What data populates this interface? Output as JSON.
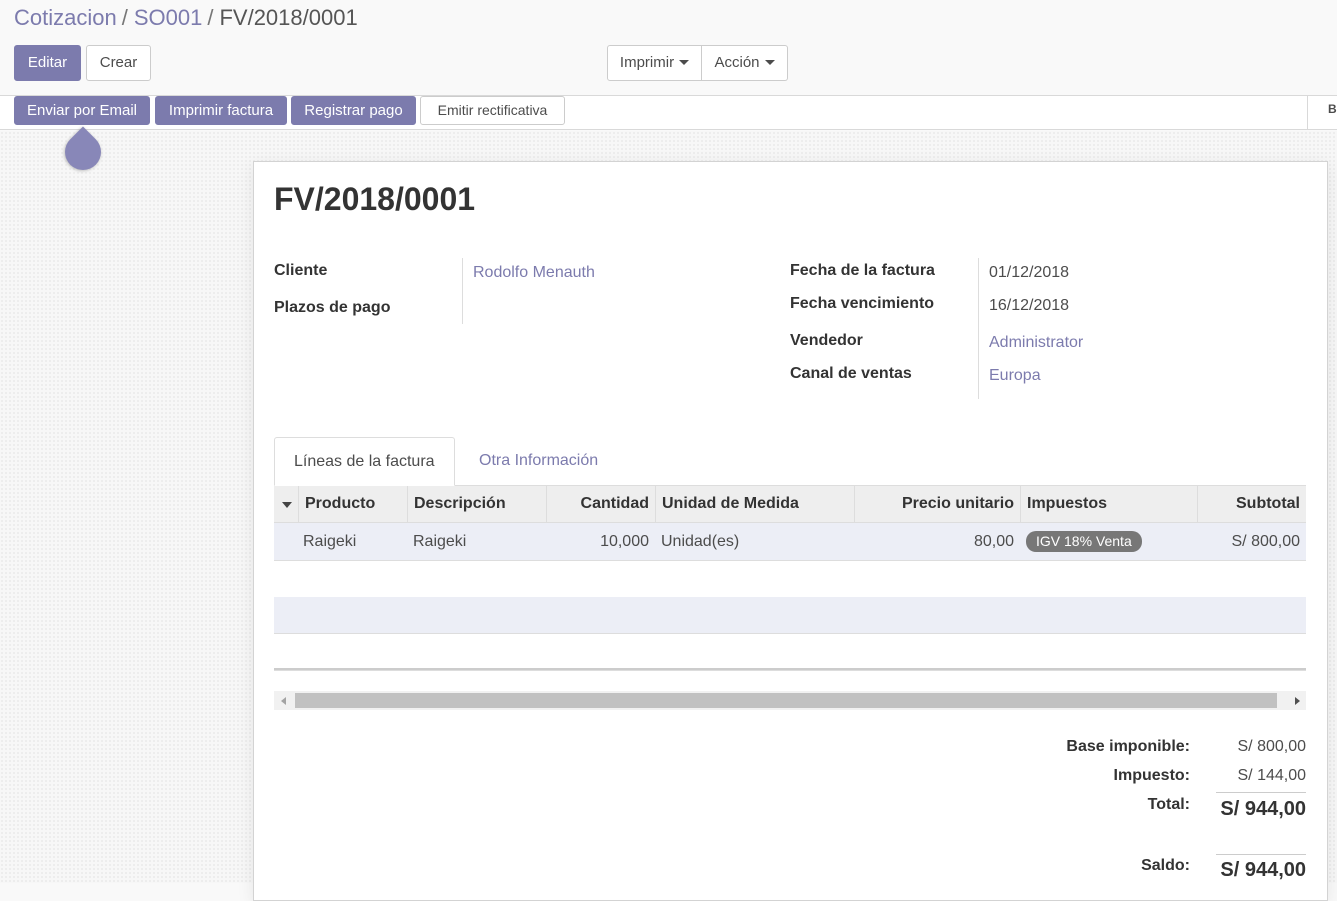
{
  "breadcrumb": {
    "items": [
      "Cotizacion",
      "SO001"
    ],
    "separator": "/",
    "current": "FV/2018/0001"
  },
  "toolbar": {
    "edit_label": "Editar",
    "create_label": "Crear",
    "print_label": "Imprimir",
    "action_label": "Acción"
  },
  "header": {
    "send_email_label": "Enviar por Email",
    "print_invoice_label": "Imprimir factura",
    "register_payment_label": "Registrar pago",
    "refund_label": "Emitir rectificativa",
    "statusbar_partial": "B"
  },
  "invoice": {
    "number": "FV/2018/0001",
    "customer_label": "Cliente",
    "customer": "Rodolfo Menauth",
    "payment_terms_label": "Plazos de pago",
    "payment_terms": "",
    "invoice_date_label": "Fecha de la factura",
    "invoice_date": "01/12/2018",
    "due_date_label": "Fecha vencimiento",
    "due_date": "16/12/2018",
    "salesperson_label": "Vendedor",
    "salesperson": "Administrator",
    "sales_channel_label": "Canal de ventas",
    "sales_channel": "Europa"
  },
  "tabs": [
    {
      "label": "Líneas de la factura",
      "active": true
    },
    {
      "label": "Otra Información",
      "active": false
    }
  ],
  "lines": {
    "columns": [
      "Producto",
      "Descripción",
      "Cantidad",
      "Unidad de Medida",
      "Precio unitario",
      "Impuestos",
      "Subtotal"
    ],
    "rows": [
      {
        "product": "Raigeki",
        "description": "Raigeki",
        "quantity": "10,000",
        "uom": "Unidad(es)",
        "unit_price": "80,00",
        "tax": "IGV 18% Venta",
        "subtotal": "S/ 800,00"
      }
    ]
  },
  "totals": {
    "untaxed_label": "Base imponible:",
    "untaxed": "S/ 800,00",
    "tax_label": "Impuesto:",
    "tax": "S/ 144,00",
    "total_label": "Total:",
    "total": "S/ 944,00",
    "residual_label": "Saldo:",
    "residual": "S/ 944,00"
  },
  "colors": {
    "primary": "#7c7bad",
    "badge": "#777777",
    "row_selected": "#eceef6"
  }
}
